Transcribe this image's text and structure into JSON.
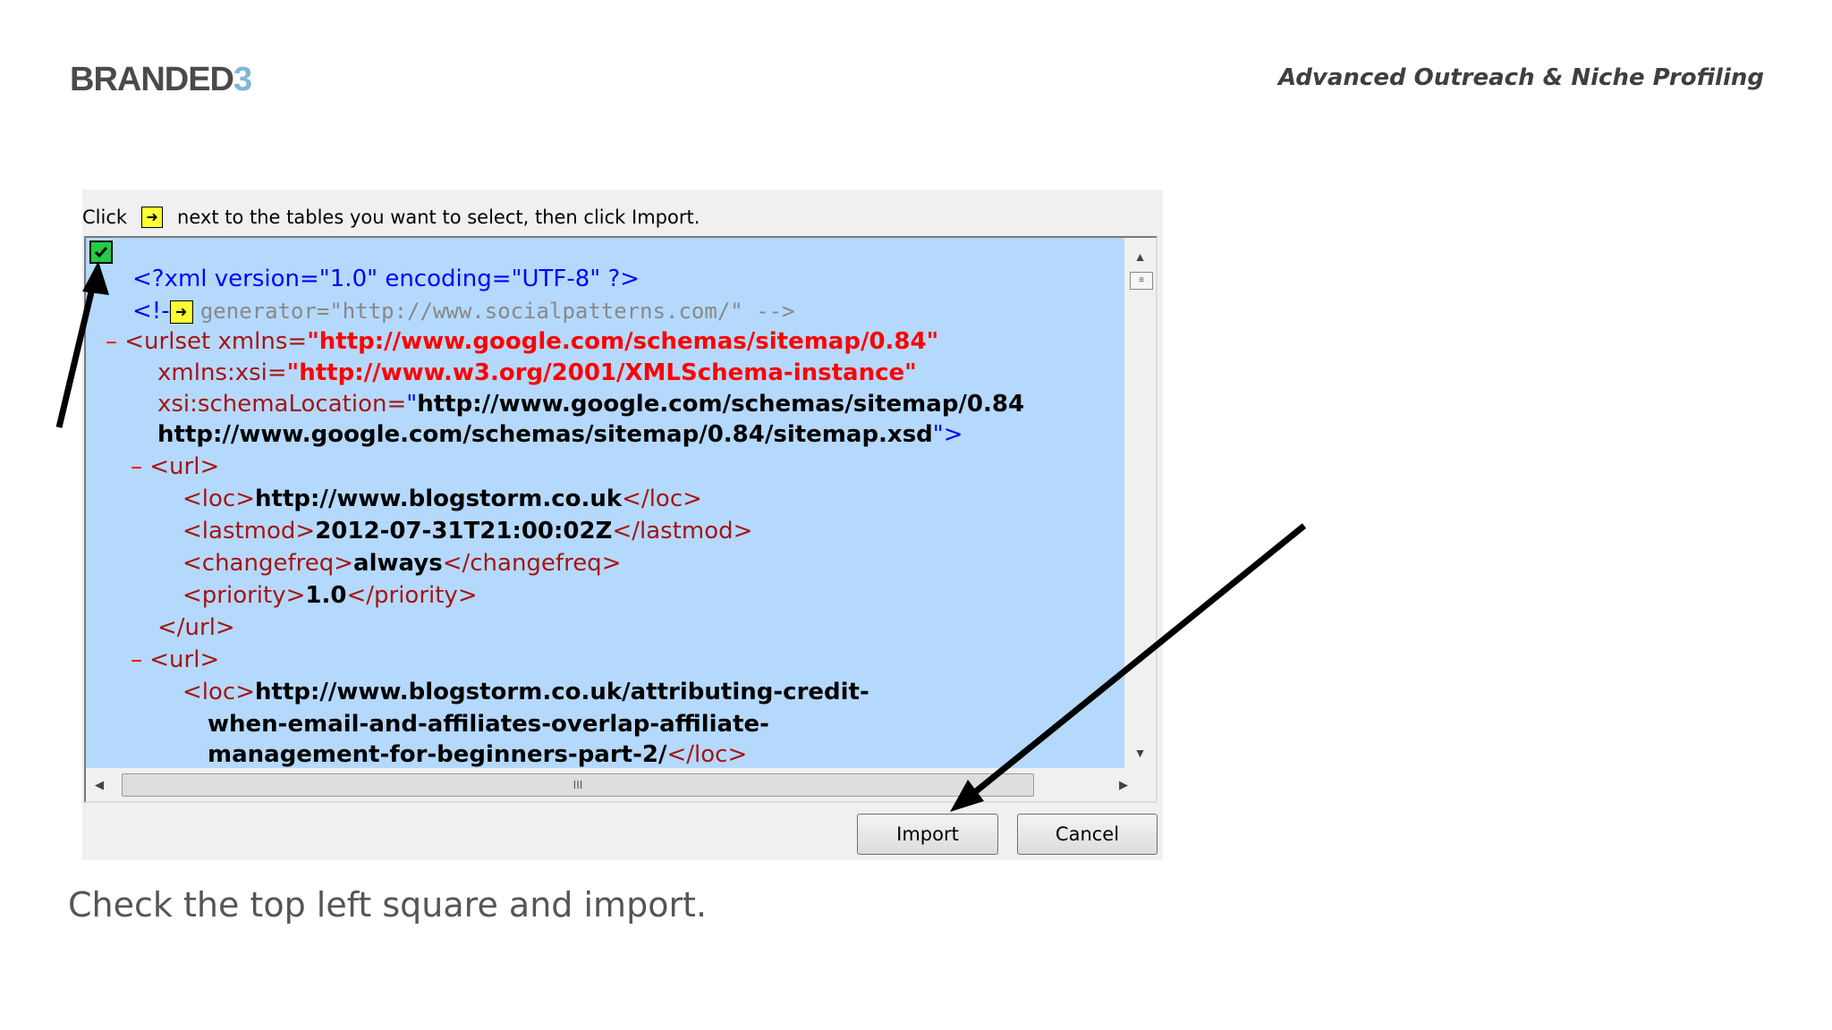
{
  "header": {
    "logo_main": "BRANDED",
    "logo_accent": "3",
    "title": "Advanced Outreach & Niche Profiling"
  },
  "dialog": {
    "instruction_click": "Click",
    "instruction_rest": "next to the tables you want to select, then click Import.",
    "xml_lines": {
      "l1": "<?xml version=\"1.0\" encoding=\"UTF-8\" ?>",
      "l2a": "<!-",
      "l2b": "generator=\"http://www.socialpatterns.com/\"  -->",
      "l3_tag": "<urlset xmlns=",
      "l3_val": "\"http://www.google.com/schemas/sitemap/0.84\"",
      "l4_attr": "xmlns:xsi=",
      "l4_val": "\"http://www.w3.org/2001/XMLSchema-instance\"",
      "l5_attr": "xsi:schemaLocation=",
      "l5_q": "\"",
      "l5_val": "http://www.google.com/schemas/sitemap/0.84",
      "l6_val": "http://www.google.com/schemas/sitemap/0.84/sitemap.xsd",
      "l6_end": "\">",
      "url_open": "<url>",
      "loc_open": "<loc>",
      "loc_close": "</loc>",
      "loc1": "http://www.blogstorm.co.uk",
      "lastmod_open": "<lastmod>",
      "lastmod_val": "2012-07-31T21:00:02Z",
      "lastmod_close": "</lastmod>",
      "changefreq_open": "<changefreq>",
      "changefreq_val": "always",
      "changefreq_close": "</changefreq>",
      "priority_open": "<priority>",
      "priority_val": "1.0",
      "priority_close": "</priority>",
      "url_close": "</url>",
      "loc2a": "http://www.blogstorm.co.uk/attributing-credit-",
      "loc2b": "when-email-and-affiliates-overlap-affiliate-",
      "loc2c": "management-for-beginners-part-2/",
      "minus": "–"
    },
    "scroll_grip": "III",
    "import_label": "Import",
    "cancel_label": "Cancel"
  },
  "caption": "Check the top left square and import.",
  "colors": {
    "xml_background": "#b5d9fc",
    "checkbox": "#22cc44",
    "highlight_arrow_box": "#ffff33"
  }
}
